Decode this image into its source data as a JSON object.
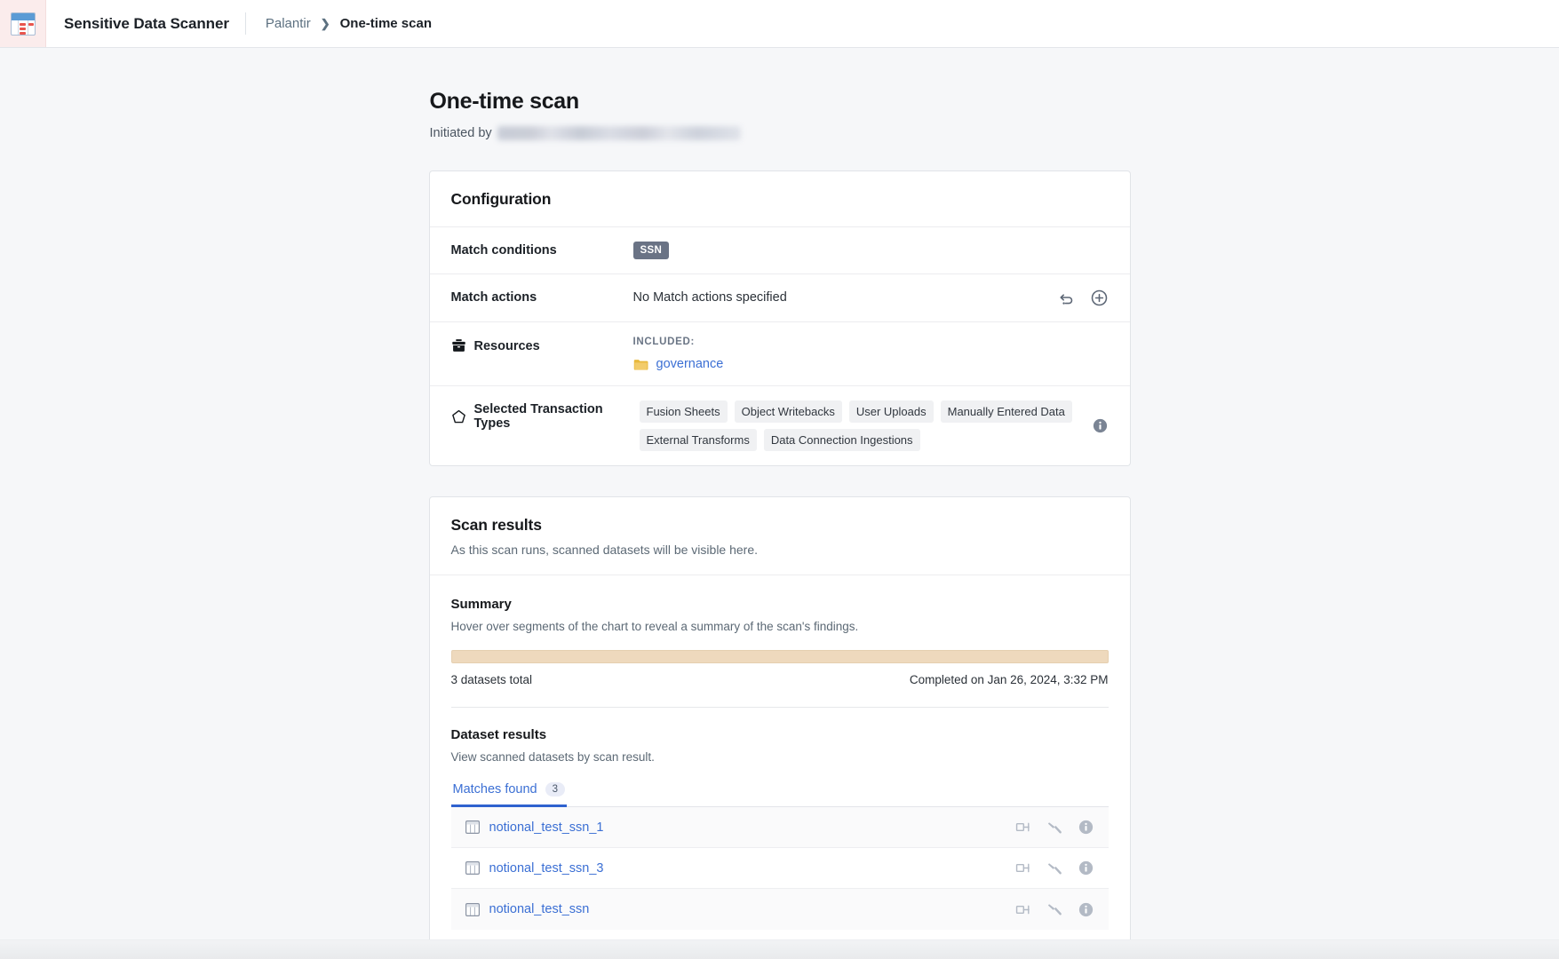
{
  "topbar": {
    "app_icon": "spreadsheet-scanner-icon",
    "app_title": "Sensitive Data Scanner",
    "breadcrumb": {
      "root": "Palantir",
      "separator": "›",
      "current": "One-time scan"
    }
  },
  "header": {
    "title": "One-time scan",
    "initiated_by_label": "Initiated by",
    "initiated_by_value": ""
  },
  "configuration": {
    "title": "Configuration",
    "rows": {
      "match_conditions": {
        "label": "Match conditions",
        "tags": [
          "SSN"
        ]
      },
      "match_actions": {
        "label": "Match actions",
        "value": "No Match actions specified",
        "actions": [
          "undo-icon",
          "add-circle-icon"
        ]
      },
      "resources": {
        "label": "Resources",
        "icon": "briefcase-icon",
        "included_label": "INCLUDED:",
        "items": [
          {
            "icon": "folder-icon",
            "name": "governance"
          }
        ]
      },
      "transaction_types": {
        "label": "Selected Transaction Types",
        "icon": "pentagon-icon",
        "tags": [
          "Fusion Sheets",
          "Object Writebacks",
          "User Uploads",
          "Manually Entered Data",
          "External Transforms",
          "Data Connection Ingestions"
        ],
        "info_icon": "info-icon"
      }
    }
  },
  "scan_results": {
    "title": "Scan results",
    "subtitle": "As this scan runs, scanned datasets will be visible here.",
    "summary": {
      "title": "Summary",
      "subtitle": "Hover over segments of the chart to reveal a summary of the scan's findings.",
      "bar_color": "#eed9bd",
      "total_label": "3 datasets total",
      "completed_label": "Completed on Jan 26, 2024, 3:32 PM"
    },
    "dataset_results": {
      "title": "Dataset results",
      "subtitle": "View scanned datasets by scan result.",
      "tabs": [
        {
          "label": "Matches found",
          "count": "3",
          "active": true
        }
      ],
      "rows": [
        {
          "icon": "table-icon",
          "name": "notional_test_ssn_1",
          "actions": [
            "derive-icon",
            "build-icon",
            "info-icon"
          ]
        },
        {
          "icon": "table-icon",
          "name": "notional_test_ssn_3",
          "actions": [
            "derive-icon",
            "build-icon",
            "info-icon"
          ]
        },
        {
          "icon": "table-icon",
          "name": "notional_test_ssn",
          "actions": [
            "derive-icon",
            "build-icon",
            "info-icon"
          ]
        }
      ]
    }
  },
  "colors": {
    "link": "#3b6fd4",
    "tag_ssn_bg": "#6a7385",
    "summary_bar": "#eed9bd",
    "active_tab_underline": "#2f62cf",
    "folder": "#e5b93c"
  }
}
